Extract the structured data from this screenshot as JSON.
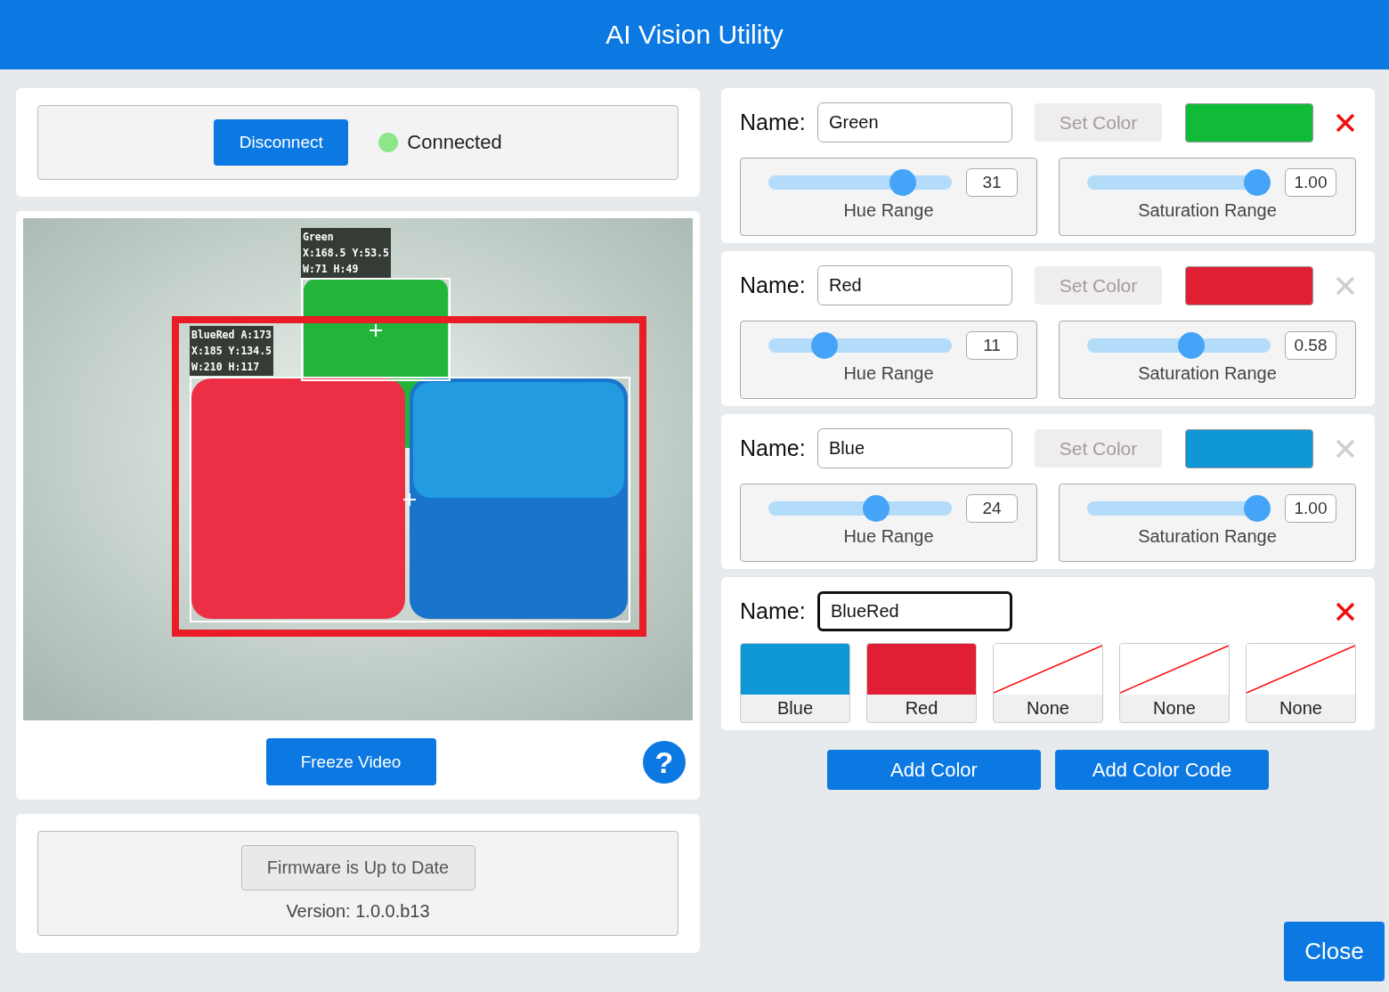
{
  "window": {
    "title": "AI Vision Utility"
  },
  "connection": {
    "button": "Disconnect",
    "status": "Connected",
    "connected": true
  },
  "video": {
    "detections": [
      {
        "kind": "color",
        "lines": [
          "Green",
          "X:168.5 Y:53.5",
          "W:71 H:49"
        ]
      },
      {
        "kind": "code",
        "lines": [
          "BlueRed A:173",
          "X:185 Y:134.5",
          "W:210 H:117"
        ]
      }
    ]
  },
  "freeze_button": "Freeze Video",
  "help": "?",
  "firmware": {
    "button": "Firmware is Up to Date",
    "version": "Version: 1.0.0.b13"
  },
  "colors": [
    {
      "name_label": "Name:",
      "name": "Green",
      "set_color": "Set Color",
      "color": "#10bb38",
      "delete_active": true,
      "hue": {
        "value": "31",
        "level": 0.775,
        "label": "Hue Range"
      },
      "saturation": {
        "value": "1.00",
        "level": 1,
        "label": "Saturation Range"
      }
    },
    {
      "name_label": "Name:",
      "name": "Red",
      "set_color": "Set Color",
      "color": "#e01e34",
      "delete_active": false,
      "hue": {
        "value": "11",
        "level": 0.275,
        "label": "Hue Range"
      },
      "saturation": {
        "value": "0.58",
        "level": 0.58,
        "label": "Saturation Range"
      }
    },
    {
      "name_label": "Name:",
      "name": "Blue",
      "set_color": "Set Color",
      "color": "#1097d6",
      "delete_active": false,
      "hue": {
        "value": "24",
        "level": 0.6,
        "label": "Hue Range"
      },
      "saturation": {
        "value": "1.00",
        "level": 1,
        "label": "Saturation Range"
      }
    }
  ],
  "color_code": {
    "name_label": "Name:",
    "name": "BlueRed",
    "focused": true,
    "delete_active": true,
    "slots": [
      {
        "label": "Blue",
        "color": "#1097d6"
      },
      {
        "label": "Red",
        "color": "#e01e34"
      },
      {
        "label": "None"
      },
      {
        "label": "None"
      },
      {
        "label": "None"
      }
    ]
  },
  "buttons": [
    "Add Color",
    "Add Color Code"
  ],
  "close": "Close"
}
